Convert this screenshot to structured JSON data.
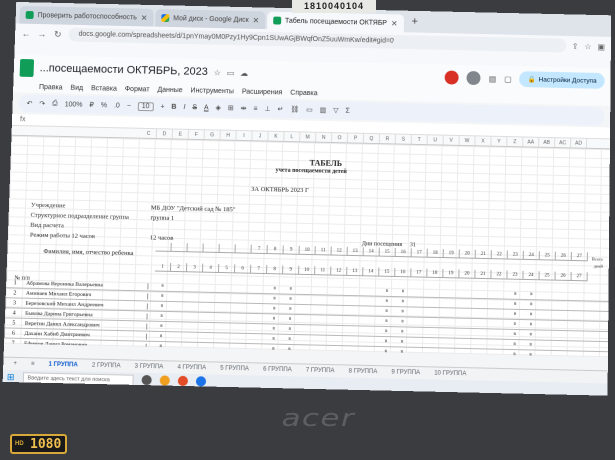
{
  "sticker": "1810040104",
  "browser": {
    "tabs": [
      {
        "label": "Проверить работоспособность",
        "active": false
      },
      {
        "label": "Мой диск - Google Диск",
        "active": false
      },
      {
        "label": "Табель посещаемости ОКТЯБР",
        "active": true
      }
    ],
    "url": "docs.google.com/spreadsheets/d/1pnYmay0M0Pzy1Hy9Cpn1SUwAGjBWqfOnZ5uuWmKw/edit#gid=0"
  },
  "doc": {
    "title": "...посещаемости ОКТЯБРЬ, 2023",
    "share_label": "Настройки Доступа",
    "menus": [
      "Правка",
      "Вид",
      "Вставка",
      "Формат",
      "Данные",
      "Инструменты",
      "Расширения",
      "Справка"
    ]
  },
  "toolbar": {
    "zoom": "100%",
    "font_size": "10"
  },
  "columns": [
    "C",
    "D",
    "E",
    "F",
    "G",
    "H",
    "I",
    "J",
    "K",
    "L",
    "M",
    "N",
    "O",
    "P",
    "Q",
    "R",
    "S",
    "T",
    "U",
    "V",
    "W",
    "X",
    "Y",
    "Z",
    "AA",
    "AB",
    "AC",
    "AD"
  ],
  "report": {
    "title": "ТАБЕЛЬ",
    "subtitle": "учета посещаемости детей",
    "date_line": "ЗА ОКТЯБРЬ 2023 Г",
    "institution_label": "Учреждение",
    "institution_value": "МБ ДОУ \"Детский сад № 185\"",
    "division_label": "Структурное подразделение группа",
    "division_value": "группа 1",
    "calc_type_label": "Вид расчета",
    "mode_label": "Режим работы 12 часов",
    "mode_value": "12 часов",
    "days_label": "Дни посещения",
    "days_value": "31",
    "name_header": "Фамилия, имя, отчество ребенка",
    "num_header": "№ п/п",
    "extra_headers": [
      "Всего",
      "дней"
    ]
  },
  "day_numbers": [
    "1",
    "2",
    "3",
    "4",
    "5",
    "6",
    "7",
    "8",
    "9",
    "10",
    "11",
    "12",
    "13",
    "14",
    "15",
    "16",
    "17",
    "18",
    "19",
    "20",
    "21",
    "22",
    "23",
    "24",
    "25",
    "26",
    "27"
  ],
  "day_numbers_top": [
    "",
    "",
    "",
    "",
    "",
    "",
    "7",
    "8",
    "9",
    "10",
    "11",
    "12",
    "13",
    "14",
    "15",
    "16",
    "17",
    "18",
    "19",
    "20",
    "21",
    "22",
    "23",
    "24",
    "25",
    "26",
    "27"
  ],
  "children": [
    {
      "num": "1",
      "name": "Абрамова Вероника Валерьевна",
      "marks": [
        "в",
        "",
        "",
        "",
        "",
        "",
        "",
        "в",
        "в",
        "",
        "",
        "",
        "",
        "",
        "в",
        "в",
        "",
        "",
        "",
        "",
        "",
        "",
        "в",
        "в",
        "",
        "",
        ""
      ]
    },
    {
      "num": "2",
      "name": "Аминаев Михаил Егорович",
      "marks": [
        "в",
        "",
        "",
        "",
        "",
        "",
        "",
        "в",
        "в",
        "",
        "",
        "",
        "",
        "",
        "в",
        "в",
        "",
        "",
        "",
        "",
        "",
        "",
        "в",
        "в",
        "",
        "",
        ""
      ]
    },
    {
      "num": "3",
      "name": "Березовский Михаил Андреевич",
      "marks": [
        "в",
        "",
        "",
        "",
        "",
        "",
        "",
        "в",
        "в",
        "",
        "",
        "",
        "",
        "",
        "в",
        "в",
        "",
        "",
        "",
        "",
        "",
        "",
        "в",
        "в",
        "",
        "",
        ""
      ]
    },
    {
      "num": "4",
      "name": "Быкова Дарина Григорьевна",
      "marks": [
        "в",
        "",
        "",
        "",
        "",
        "",
        "",
        "в",
        "в",
        "",
        "",
        "",
        "",
        "",
        "в",
        "в",
        "",
        "",
        "",
        "",
        "",
        "",
        "в",
        "в",
        "",
        "",
        ""
      ]
    },
    {
      "num": "5",
      "name": "Веретин Данил Александрович",
      "marks": [
        "в",
        "",
        "",
        "",
        "",
        "",
        "",
        "в",
        "в",
        "",
        "",
        "",
        "",
        "",
        "в",
        "в",
        "",
        "",
        "",
        "",
        "",
        "",
        "в",
        "в",
        "",
        "",
        ""
      ]
    },
    {
      "num": "6",
      "name": "Дахани Хабиб Дмитриевич",
      "marks": [
        "в",
        "",
        "",
        "",
        "",
        "",
        "",
        "в",
        "в",
        "",
        "",
        "",
        "",
        "",
        "в",
        "в",
        "",
        "",
        "",
        "",
        "",
        "",
        "в",
        "в",
        "",
        "",
        ""
      ]
    },
    {
      "num": "7",
      "name": "Ефимов Данил Романович",
      "marks": [
        "в",
        "",
        "",
        "",
        "",
        "",
        "",
        "в",
        "в",
        "",
        "",
        "",
        "",
        "",
        "в",
        "в",
        "",
        "",
        "",
        "",
        "",
        "",
        "в",
        "в",
        "",
        "",
        ""
      ]
    }
  ],
  "sheet_tabs": [
    {
      "label": "1 ГРУППА",
      "active": true
    },
    {
      "label": "2 ГРУППА",
      "active": false
    },
    {
      "label": "3 ГРУППА",
      "active": false
    },
    {
      "label": "4 ГРУППА",
      "active": false
    },
    {
      "label": "5 ГРУППА",
      "active": false
    },
    {
      "label": "6 ГРУППА",
      "active": false
    },
    {
      "label": "7 ГРУППА",
      "active": false
    },
    {
      "label": "8 ГРУППА",
      "active": false
    },
    {
      "label": "9 ГРУППА",
      "active": false
    },
    {
      "label": "10 ГРУППА",
      "active": false
    }
  ],
  "taskbar": {
    "search_placeholder": "Введите здесь текст для поиска"
  },
  "laptop": {
    "brand": "acer",
    "badge_hd": "HD",
    "badge_res": "1080"
  },
  "colors": {
    "accent": "#0b57d0",
    "share_bg": "#c2e7ff",
    "sheets_green": "#0f9d58"
  }
}
